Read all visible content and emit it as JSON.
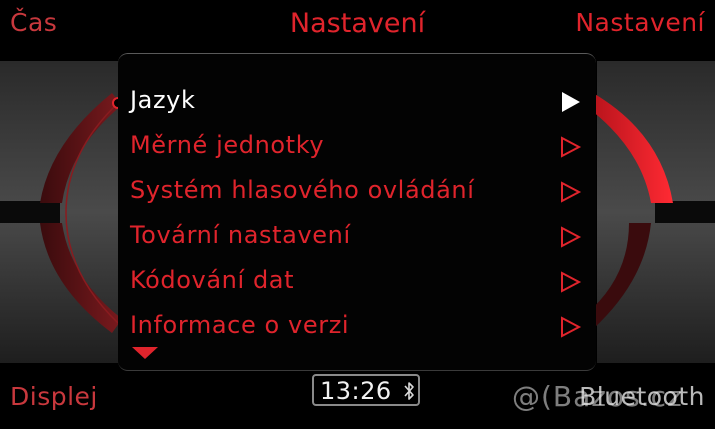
{
  "header": {
    "title": "Nastavení",
    "left_shortcut": "Čas",
    "right_shortcut": "Nastavení"
  },
  "footer": {
    "left_shortcut": "Displej",
    "right_shortcut": "Bluetooth",
    "clock": "13:26",
    "watermark": "@(Bazos.cz"
  },
  "menu": {
    "items": [
      {
        "label": "Jazyk",
        "selected": true
      },
      {
        "label": "Měrné jednotky",
        "selected": false
      },
      {
        "label": "Systém hlasového ovládání",
        "selected": false
      },
      {
        "label": "Tovární nastavení",
        "selected": false
      },
      {
        "label": "Kódování dat",
        "selected": false
      },
      {
        "label": "Informace o verzi",
        "selected": false
      }
    ]
  },
  "colors": {
    "accent_red": "#e0242c",
    "selected_text": "#ffffff",
    "background": "#000000"
  },
  "icons": {
    "submenu": "triangle-right-icon",
    "more_below": "triangle-down-icon",
    "bluetooth": "bluetooth-icon"
  }
}
